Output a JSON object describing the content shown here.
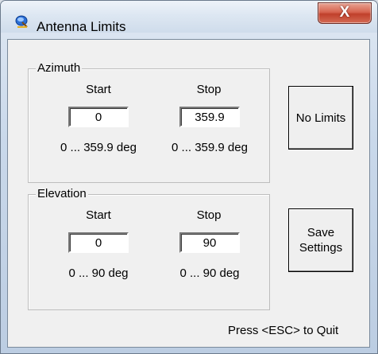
{
  "window": {
    "title": "Antenna Limits",
    "close_glyph": "X",
    "icon": "satellite-dish-icon"
  },
  "azimuth": {
    "legend": "Azimuth",
    "start_label": "Start",
    "stop_label": "Stop",
    "start_value": "0",
    "stop_value": "359.9",
    "start_range": "0 ... 359.9 deg",
    "stop_range": "0 ... 359.9 deg"
  },
  "elevation": {
    "legend": "Elevation",
    "start_label": "Start",
    "stop_label": "Stop",
    "start_value": "0",
    "stop_value": "90",
    "start_range": "0 ... 90 deg",
    "stop_range": "0 ... 90 deg"
  },
  "buttons": {
    "no_limits": "No Limits",
    "save_line1": "Save",
    "save_line2": "Settings"
  },
  "status": {
    "hint": "Press <ESC> to Quit"
  },
  "colors": {
    "close_button": "#c9462f",
    "dialog_background": "#f0f0f0"
  }
}
